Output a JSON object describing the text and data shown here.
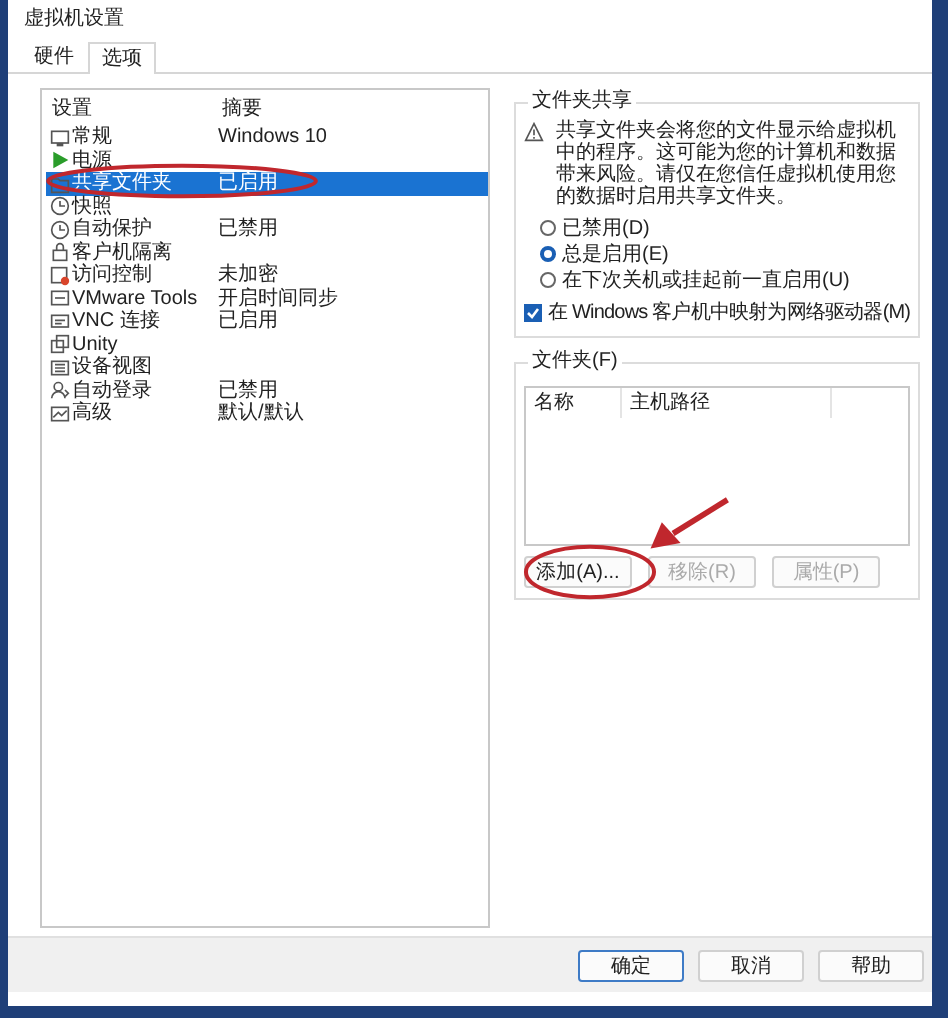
{
  "window": {
    "title": "虚拟机设置"
  },
  "tabs": [
    {
      "label": "硬件",
      "selected": false
    },
    {
      "label": "选项",
      "selected": true
    }
  ],
  "settings_list": {
    "columns": [
      "设置",
      "摘要"
    ],
    "rows": [
      {
        "name": "常规",
        "summary": "Windows 10",
        "selected": false
      },
      {
        "name": "电源",
        "summary": "",
        "selected": false
      },
      {
        "name": "共享文件夹",
        "summary": "已启用",
        "selected": true
      },
      {
        "name": "快照",
        "summary": "",
        "selected": false
      },
      {
        "name": "自动保护",
        "summary": "已禁用",
        "selected": false
      },
      {
        "name": "客户机隔离",
        "summary": "",
        "selected": false
      },
      {
        "name": "访问控制",
        "summary": "未加密",
        "selected": false
      },
      {
        "name": "VMware Tools",
        "summary": "开启时间同步",
        "selected": false
      },
      {
        "name": "VNC 连接",
        "summary": "已启用",
        "selected": false
      },
      {
        "name": "Unity",
        "summary": "",
        "selected": false
      },
      {
        "name": "设备视图",
        "summary": "",
        "selected": false
      },
      {
        "name": "自动登录",
        "summary": "已禁用",
        "selected": false
      },
      {
        "name": "高级",
        "summary": "默认/默认",
        "selected": false
      }
    ]
  },
  "folder_sharing": {
    "title": "文件夹共享",
    "warning": "共享文件夹会将您的文件显示给虚拟机中的程序。这可能为您的计算机和数据带来风险。请仅在您信任虚拟机使用您的数据时启用共享文件夹。",
    "options": [
      {
        "label": "已禁用(D)",
        "selected": false
      },
      {
        "label": "总是启用(E)",
        "selected": true
      },
      {
        "label": "在下次关机或挂起前一直启用(U)",
        "selected": false
      }
    ],
    "map_drive": {
      "label": "在 Windows 客户机中映射为网络驱动器(M)",
      "checked": true
    }
  },
  "folders": {
    "title": "文件夹(F)",
    "columns": [
      "名称",
      "主机路径"
    ],
    "buttons": [
      {
        "label": "添加(A)...",
        "disabled": false
      },
      {
        "label": "移除(R)",
        "disabled": true
      },
      {
        "label": "属性(P)",
        "disabled": true
      }
    ]
  },
  "footer_buttons": [
    {
      "label": "确定",
      "default": true
    },
    {
      "label": "取消",
      "default": false
    },
    {
      "label": "帮助",
      "default": false
    }
  ],
  "annotations": [
    {
      "kind": "ellipse"
    },
    {
      "kind": "ellipse"
    },
    {
      "kind": "arrow"
    }
  ]
}
